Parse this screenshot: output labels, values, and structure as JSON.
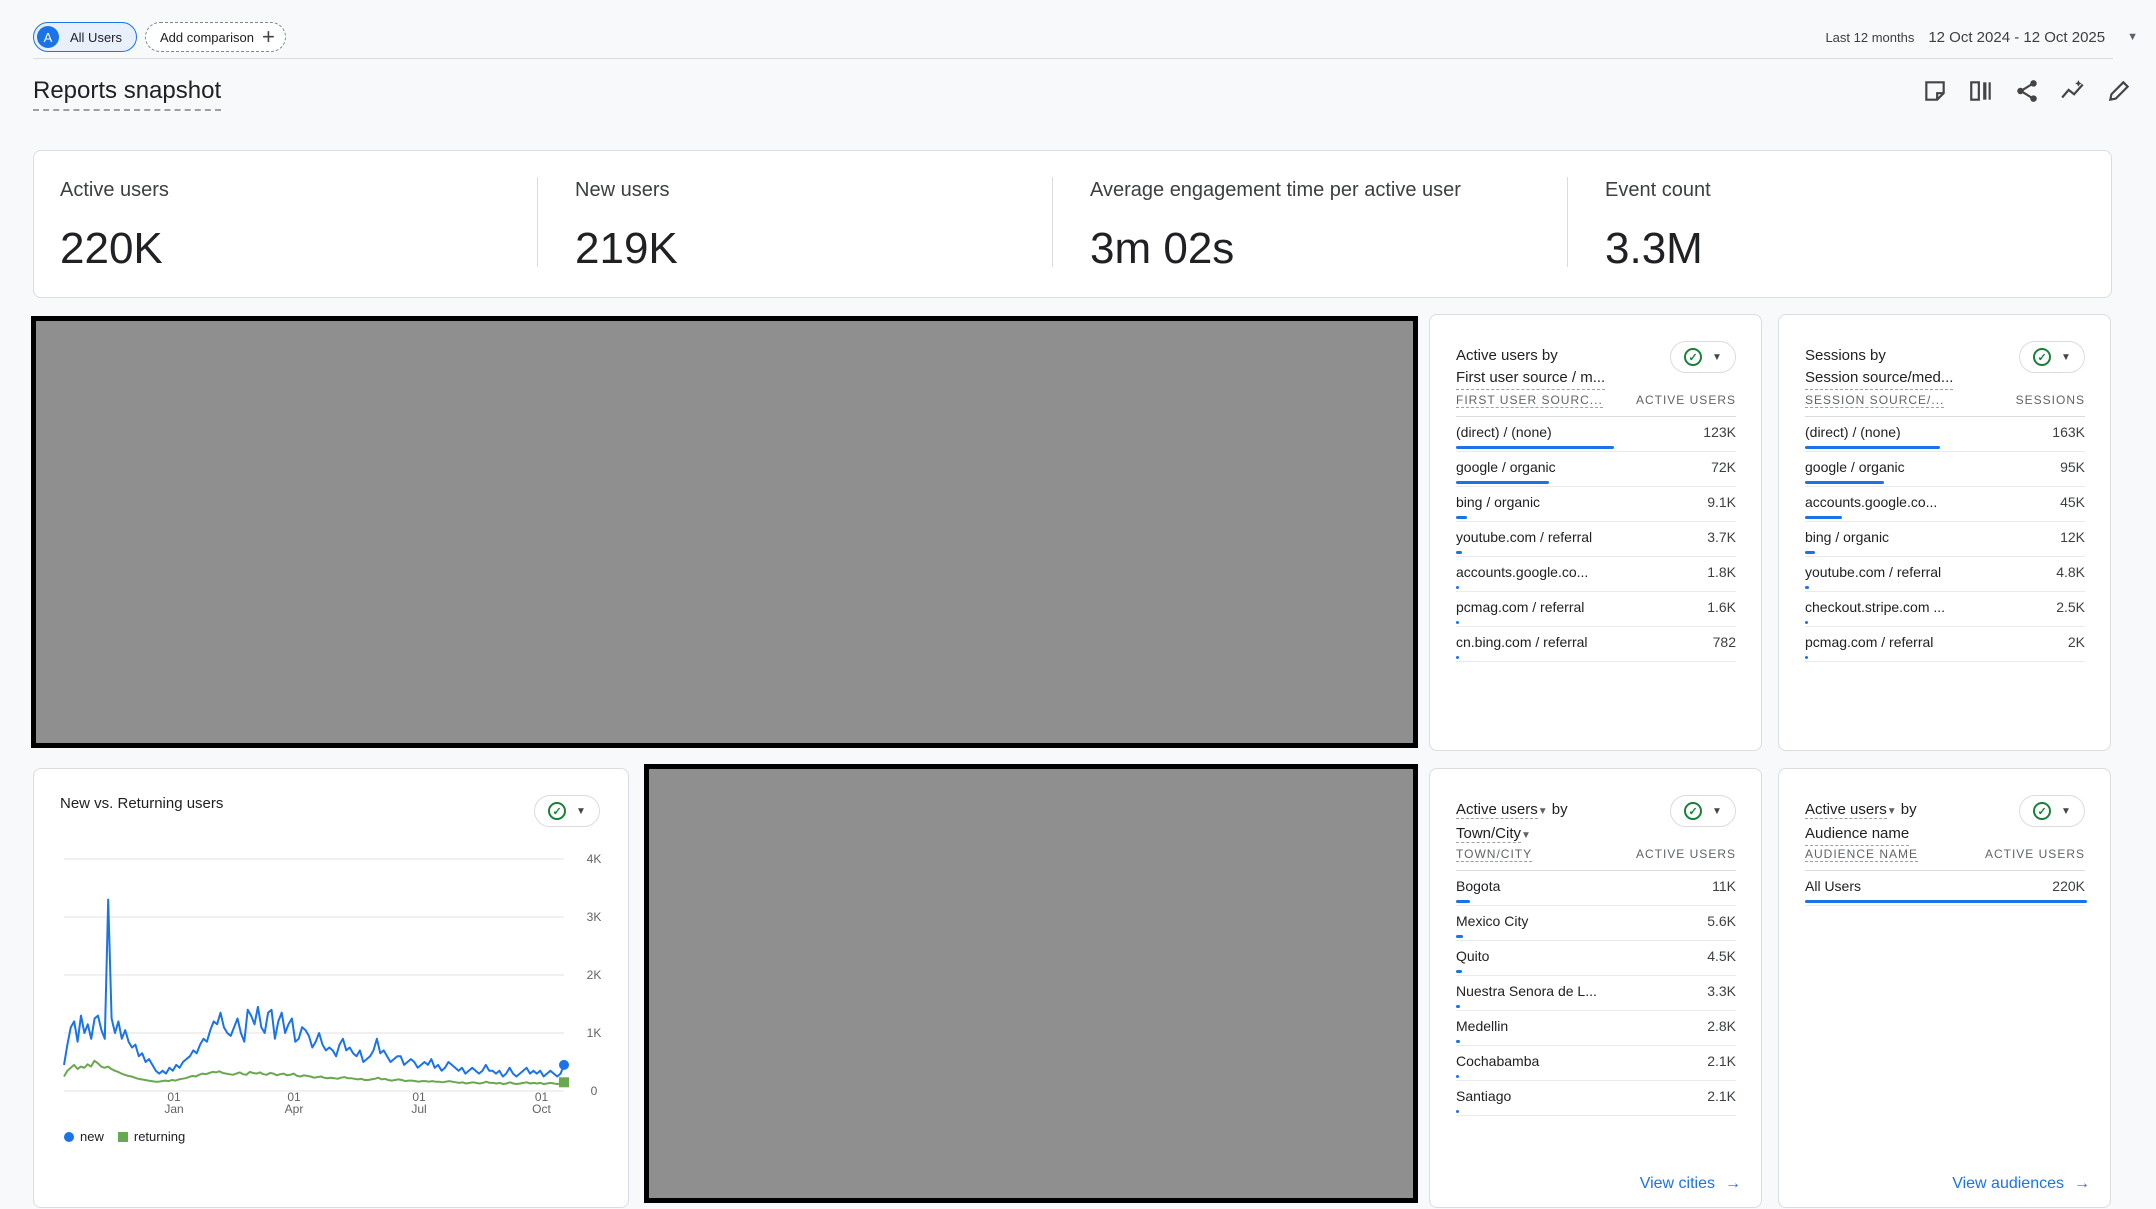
{
  "top_bar": {
    "segment_avatar": "A",
    "segment_label": "All Users",
    "add_comparison_label": "Add comparison",
    "date_range_label": "Last 12 months",
    "date_range_value": "12 Oct 2024 - 12 Oct 2025"
  },
  "page_title": "Reports snapshot",
  "kpis": [
    {
      "name": "Active users",
      "value": "220K"
    },
    {
      "name": "New users",
      "value": "219K"
    },
    {
      "name": "Average engagement time per active user",
      "value": "3m 02s"
    },
    {
      "name": "Event count",
      "value": "3.3M"
    }
  ],
  "card_first_user_source": {
    "title_line1": "Active users by",
    "title_line2": "First user source / m...",
    "col1": "FIRST USER SOURC...",
    "col2": "ACTIVE USERS",
    "rows": [
      {
        "label": "(direct) / (none)",
        "value": "123K",
        "share": 0.56
      },
      {
        "label": "google / organic",
        "value": "72K",
        "share": 0.33
      },
      {
        "label": "bing / organic",
        "value": "9.1K",
        "share": 0.04
      },
      {
        "label": "youtube.com / referral",
        "value": "3.7K",
        "share": 0.02
      },
      {
        "label": "accounts.google.co...",
        "value": "1.8K",
        "share": 0.01
      },
      {
        "label": "pcmag.com / referral",
        "value": "1.6K",
        "share": 0.01
      },
      {
        "label": "cn.bing.com / referral",
        "value": "782",
        "share": 0.005
      }
    ]
  },
  "card_session_source": {
    "title_line1": "Sessions by",
    "title_line2": "Session source/med...",
    "col1": "SESSION SOURCE/...",
    "col2": "SESSIONS",
    "rows": [
      {
        "label": "(direct) / (none)",
        "value": "163K",
        "share": 0.48
      },
      {
        "label": "google / organic",
        "value": "95K",
        "share": 0.28
      },
      {
        "label": "accounts.google.co...",
        "value": "45K",
        "share": 0.13
      },
      {
        "label": "bing / organic",
        "value": "12K",
        "share": 0.035
      },
      {
        "label": "youtube.com / referral",
        "value": "4.8K",
        "share": 0.014
      },
      {
        "label": "checkout.stripe.com ...",
        "value": "2.5K",
        "share": 0.007
      },
      {
        "label": "pcmag.com / referral",
        "value": "2K",
        "share": 0.006
      }
    ]
  },
  "card_city": {
    "title_line1": "Active users",
    "title_by": "by",
    "title_line2": "Town/City",
    "col1": "TOWN/CITY",
    "col2": "ACTIVE USERS",
    "rows": [
      {
        "label": "Bogota",
        "value": "11K",
        "share": 0.05
      },
      {
        "label": "Mexico City",
        "value": "5.6K",
        "share": 0.025
      },
      {
        "label": "Quito",
        "value": "4.5K",
        "share": 0.02
      },
      {
        "label": "Nuestra Senora de L...",
        "value": "3.3K",
        "share": 0.015
      },
      {
        "label": "Medellin",
        "value": "2.8K",
        "share": 0.013
      },
      {
        "label": "Cochabamba",
        "value": "2.1K",
        "share": 0.01
      },
      {
        "label": "Santiago",
        "value": "2.1K",
        "share": 0.01
      }
    ],
    "link": "View cities"
  },
  "card_audience": {
    "title_line1": "Active users",
    "title_by": "by",
    "title_line2": "Audience name",
    "col1": "AUDIENCE NAME",
    "col2": "ACTIVE USERS",
    "rows": [
      {
        "label": "All Users",
        "value": "220K",
        "share": 1.0
      }
    ],
    "link": "View audiences"
  },
  "chart_card": {
    "title": "New vs. Returning users"
  },
  "chart_data": {
    "type": "line",
    "title": "New vs. Returning users",
    "xlabel": "",
    "ylabel": "",
    "ylim": [
      0,
      4000
    ],
    "y_ticks": [
      "4K",
      "3K",
      "2K",
      "1K",
      "0"
    ],
    "x_ticks": [
      {
        "day": "01",
        "month": "Jan"
      },
      {
        "day": "01",
        "month": "Apr"
      },
      {
        "day": "01",
        "month": "Jul"
      },
      {
        "day": "01",
        "month": "Oct"
      }
    ],
    "x_range": [
      "2024-10-12",
      "2025-10-12"
    ],
    "grid": true,
    "legend": "bottom-left",
    "series": [
      {
        "name": "new",
        "color": "#1a73e8",
        "values": [
          450,
          800,
          1100,
          1200,
          850,
          1300,
          1000,
          1150,
          900,
          1250,
          1300,
          1050,
          900,
          3300,
          1250,
          1000,
          1200,
          900,
          1050,
          850,
          750,
          800,
          600,
          650,
          500,
          550,
          450,
          350,
          300,
          350,
          300,
          400,
          350,
          450,
          400,
          500,
          550,
          600,
          700,
          650,
          800,
          900,
          850,
          1050,
          1200,
          1150,
          1350,
          1100,
          1000,
          950,
          1100,
          1250,
          1000,
          850,
          1400,
          1300,
          1150,
          1450,
          1100,
          1000,
          1350,
          1400,
          900,
          1200,
          1350,
          1000,
          1150,
          1250,
          850,
          900,
          1100,
          1050,
          950,
          750,
          850,
          1000,
          800,
          700,
          750,
          700,
          600,
          800,
          900,
          700,
          750,
          650,
          600,
          700,
          500,
          550,
          600,
          700,
          900,
          650,
          700,
          600,
          500,
          550,
          600,
          600,
          450,
          500,
          550,
          500,
          400,
          450,
          500,
          450,
          550,
          400,
          450,
          350,
          400,
          500,
          450,
          400,
          350,
          400,
          300,
          350,
          400,
          350,
          300,
          350,
          450,
          350,
          350,
          300,
          350,
          250,
          300,
          400,
          300,
          250,
          300,
          350,
          400,
          300,
          350,
          300,
          350,
          250,
          300,
          350,
          300,
          250,
          300,
          450
        ]
      },
      {
        "name": "returning",
        "color": "#6aa84f",
        "values": [
          250,
          350,
          400,
          450,
          380,
          420,
          400,
          460,
          420,
          520,
          480,
          420,
          400,
          420,
          380,
          350,
          330,
          300,
          280,
          260,
          250,
          230,
          210,
          200,
          190,
          180,
          170,
          160,
          160,
          170,
          180,
          170,
          190,
          180,
          200,
          210,
          220,
          240,
          260,
          250,
          280,
          300,
          290,
          310,
          330,
          320,
          340,
          310,
          300,
          290,
          280,
          300,
          320,
          290,
          280,
          330,
          310,
          300,
          320,
          290,
          280,
          310,
          300,
          270,
          290,
          300,
          270,
          280,
          300,
          260,
          250,
          270,
          260,
          250,
          230,
          240,
          250,
          230,
          220,
          230,
          220,
          210,
          230,
          240,
          220,
          220,
          210,
          200,
          210,
          190,
          190,
          200,
          210,
          230,
          200,
          210,
          190,
          180,
          190,
          200,
          190,
          170,
          180,
          180,
          170,
          160,
          170,
          170,
          160,
          170,
          160,
          160,
          150,
          160,
          170,
          160,
          150,
          140,
          150,
          130,
          140,
          150,
          140,
          130,
          140,
          160,
          140,
          140,
          130,
          140,
          120,
          130,
          150,
          130,
          120,
          130,
          140,
          150,
          130,
          140,
          130,
          140,
          120,
          130,
          140,
          130,
          120,
          130,
          150
        ]
      }
    ],
    "end_markers": {
      "new": 450,
      "returning": 150
    }
  }
}
